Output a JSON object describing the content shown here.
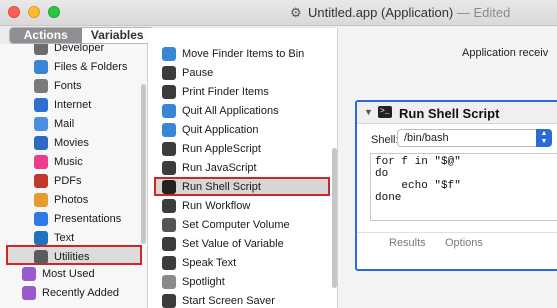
{
  "window": {
    "title": "Untitled.app (Application)",
    "edited": "— Edited"
  },
  "segments": {
    "actions": "Actions",
    "variables": "Variables"
  },
  "library": {
    "items": [
      {
        "label": "Developer",
        "icon": "hammer-icon",
        "color": "#6b6b6b"
      },
      {
        "label": "Files & Folders",
        "icon": "finder-icon",
        "color": "#3a86d6"
      },
      {
        "label": "Fonts",
        "icon": "font-icon",
        "color": "#7a7a7a"
      },
      {
        "label": "Internet",
        "icon": "globe-icon",
        "color": "#2f6fcf"
      },
      {
        "label": "Mail",
        "icon": "stamp-icon",
        "color": "#4a8fe0"
      },
      {
        "label": "Movies",
        "icon": "quicktime-icon",
        "color": "#2d6ac5"
      },
      {
        "label": "Music",
        "icon": "music-icon",
        "color": "#e83e8c"
      },
      {
        "label": "PDFs",
        "icon": "pdf-icon",
        "color": "#c0392b"
      },
      {
        "label": "Photos",
        "icon": "photos-icon",
        "color": "#e59a2c"
      },
      {
        "label": "Presentations",
        "icon": "keynote-icon",
        "color": "#2c7be5"
      },
      {
        "label": "Text",
        "icon": "text-icon",
        "color": "#1e73be"
      },
      {
        "label": "Utilities",
        "icon": "utilities-icon",
        "color": "#5b5b5b"
      }
    ],
    "smart_groups": [
      {
        "label": "Most Used",
        "icon": "smart-folder-icon",
        "color": "#9b59d0"
      },
      {
        "label": "Recently Added",
        "icon": "smart-folder-icon",
        "color": "#9b59d0"
      }
    ]
  },
  "actions_list": {
    "items": [
      {
        "label": "Move Finder Items to Bin",
        "icon": "finder-icon",
        "color": "#3a86d6"
      },
      {
        "label": "Pause",
        "icon": "automator-icon",
        "color": "#3c3c3c"
      },
      {
        "label": "Print Finder Items",
        "icon": "automator-icon",
        "color": "#3c3c3c"
      },
      {
        "label": "Quit All Applications",
        "icon": "app-icon",
        "color": "#3a86d6"
      },
      {
        "label": "Quit Application",
        "icon": "app-icon",
        "color": "#3a86d6"
      },
      {
        "label": "Run AppleScript",
        "icon": "automator-icon",
        "color": "#3c3c3c"
      },
      {
        "label": "Run JavaScript",
        "icon": "automator-icon",
        "color": "#3c3c3c"
      },
      {
        "label": "Run Shell Script",
        "icon": "terminal-icon",
        "color": "#222222"
      },
      {
        "label": "Run Workflow",
        "icon": "automator-icon",
        "color": "#3c3c3c"
      },
      {
        "label": "Set Computer Volume",
        "icon": "speaker-icon",
        "color": "#555555"
      },
      {
        "label": "Set Value of Variable",
        "icon": "automator-icon",
        "color": "#3c3c3c"
      },
      {
        "label": "Speak Text",
        "icon": "automator-icon",
        "color": "#3c3c3c"
      },
      {
        "label": "Spotlight",
        "icon": "spotlight-icon",
        "color": "#8a8a8a"
      },
      {
        "label": "Start Screen Saver",
        "icon": "automator-icon",
        "color": "#3c3c3c"
      }
    ]
  },
  "workflow": {
    "receives_text": "Application receiv",
    "action": {
      "title": "Run Shell Script",
      "shell_label": "Shell:",
      "shell_value": "/bin/bash",
      "script": "for f in \"$@\"\ndo\n    echo \"$f\"\ndone",
      "tab_results": "Results",
      "tab_options": "Options"
    }
  },
  "colors": {
    "selection_outline": "#d0242b",
    "accent": "#2a6bd8"
  }
}
